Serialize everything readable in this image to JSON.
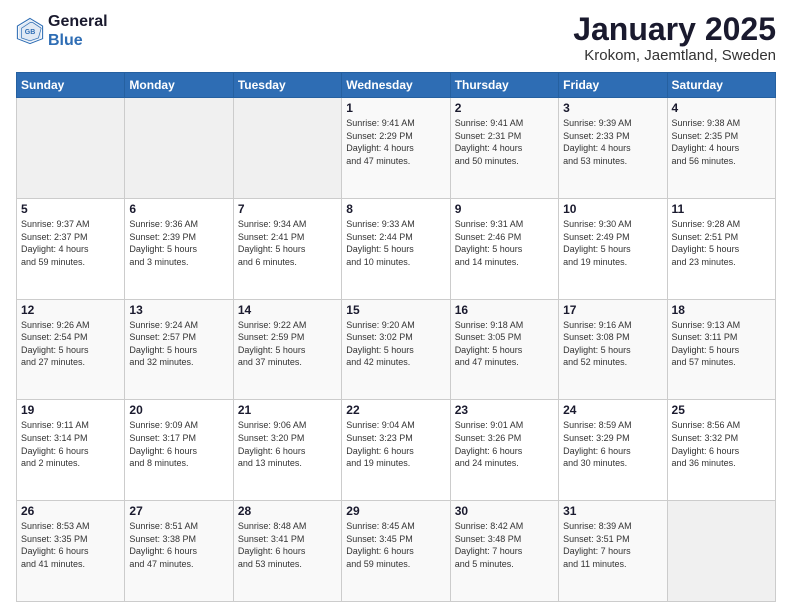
{
  "logo": {
    "line1": "General",
    "line2": "Blue"
  },
  "title": "January 2025",
  "subtitle": "Krokom, Jaemtland, Sweden",
  "weekdays": [
    "Sunday",
    "Monday",
    "Tuesday",
    "Wednesday",
    "Thursday",
    "Friday",
    "Saturday"
  ],
  "weeks": [
    [
      {
        "day": "",
        "info": ""
      },
      {
        "day": "",
        "info": ""
      },
      {
        "day": "",
        "info": ""
      },
      {
        "day": "1",
        "info": "Sunrise: 9:41 AM\nSunset: 2:29 PM\nDaylight: 4 hours\nand 47 minutes."
      },
      {
        "day": "2",
        "info": "Sunrise: 9:41 AM\nSunset: 2:31 PM\nDaylight: 4 hours\nand 50 minutes."
      },
      {
        "day": "3",
        "info": "Sunrise: 9:39 AM\nSunset: 2:33 PM\nDaylight: 4 hours\nand 53 minutes."
      },
      {
        "day": "4",
        "info": "Sunrise: 9:38 AM\nSunset: 2:35 PM\nDaylight: 4 hours\nand 56 minutes."
      }
    ],
    [
      {
        "day": "5",
        "info": "Sunrise: 9:37 AM\nSunset: 2:37 PM\nDaylight: 4 hours\nand 59 minutes."
      },
      {
        "day": "6",
        "info": "Sunrise: 9:36 AM\nSunset: 2:39 PM\nDaylight: 5 hours\nand 3 minutes."
      },
      {
        "day": "7",
        "info": "Sunrise: 9:34 AM\nSunset: 2:41 PM\nDaylight: 5 hours\nand 6 minutes."
      },
      {
        "day": "8",
        "info": "Sunrise: 9:33 AM\nSunset: 2:44 PM\nDaylight: 5 hours\nand 10 minutes."
      },
      {
        "day": "9",
        "info": "Sunrise: 9:31 AM\nSunset: 2:46 PM\nDaylight: 5 hours\nand 14 minutes."
      },
      {
        "day": "10",
        "info": "Sunrise: 9:30 AM\nSunset: 2:49 PM\nDaylight: 5 hours\nand 19 minutes."
      },
      {
        "day": "11",
        "info": "Sunrise: 9:28 AM\nSunset: 2:51 PM\nDaylight: 5 hours\nand 23 minutes."
      }
    ],
    [
      {
        "day": "12",
        "info": "Sunrise: 9:26 AM\nSunset: 2:54 PM\nDaylight: 5 hours\nand 27 minutes."
      },
      {
        "day": "13",
        "info": "Sunrise: 9:24 AM\nSunset: 2:57 PM\nDaylight: 5 hours\nand 32 minutes."
      },
      {
        "day": "14",
        "info": "Sunrise: 9:22 AM\nSunset: 2:59 PM\nDaylight: 5 hours\nand 37 minutes."
      },
      {
        "day": "15",
        "info": "Sunrise: 9:20 AM\nSunset: 3:02 PM\nDaylight: 5 hours\nand 42 minutes."
      },
      {
        "day": "16",
        "info": "Sunrise: 9:18 AM\nSunset: 3:05 PM\nDaylight: 5 hours\nand 47 minutes."
      },
      {
        "day": "17",
        "info": "Sunrise: 9:16 AM\nSunset: 3:08 PM\nDaylight: 5 hours\nand 52 minutes."
      },
      {
        "day": "18",
        "info": "Sunrise: 9:13 AM\nSunset: 3:11 PM\nDaylight: 5 hours\nand 57 minutes."
      }
    ],
    [
      {
        "day": "19",
        "info": "Sunrise: 9:11 AM\nSunset: 3:14 PM\nDaylight: 6 hours\nand 2 minutes."
      },
      {
        "day": "20",
        "info": "Sunrise: 9:09 AM\nSunset: 3:17 PM\nDaylight: 6 hours\nand 8 minutes."
      },
      {
        "day": "21",
        "info": "Sunrise: 9:06 AM\nSunset: 3:20 PM\nDaylight: 6 hours\nand 13 minutes."
      },
      {
        "day": "22",
        "info": "Sunrise: 9:04 AM\nSunset: 3:23 PM\nDaylight: 6 hours\nand 19 minutes."
      },
      {
        "day": "23",
        "info": "Sunrise: 9:01 AM\nSunset: 3:26 PM\nDaylight: 6 hours\nand 24 minutes."
      },
      {
        "day": "24",
        "info": "Sunrise: 8:59 AM\nSunset: 3:29 PM\nDaylight: 6 hours\nand 30 minutes."
      },
      {
        "day": "25",
        "info": "Sunrise: 8:56 AM\nSunset: 3:32 PM\nDaylight: 6 hours\nand 36 minutes."
      }
    ],
    [
      {
        "day": "26",
        "info": "Sunrise: 8:53 AM\nSunset: 3:35 PM\nDaylight: 6 hours\nand 41 minutes."
      },
      {
        "day": "27",
        "info": "Sunrise: 8:51 AM\nSunset: 3:38 PM\nDaylight: 6 hours\nand 47 minutes."
      },
      {
        "day": "28",
        "info": "Sunrise: 8:48 AM\nSunset: 3:41 PM\nDaylight: 6 hours\nand 53 minutes."
      },
      {
        "day": "29",
        "info": "Sunrise: 8:45 AM\nSunset: 3:45 PM\nDaylight: 6 hours\nand 59 minutes."
      },
      {
        "day": "30",
        "info": "Sunrise: 8:42 AM\nSunset: 3:48 PM\nDaylight: 7 hours\nand 5 minutes."
      },
      {
        "day": "31",
        "info": "Sunrise: 8:39 AM\nSunset: 3:51 PM\nDaylight: 7 hours\nand 11 minutes."
      },
      {
        "day": "",
        "info": ""
      }
    ]
  ]
}
